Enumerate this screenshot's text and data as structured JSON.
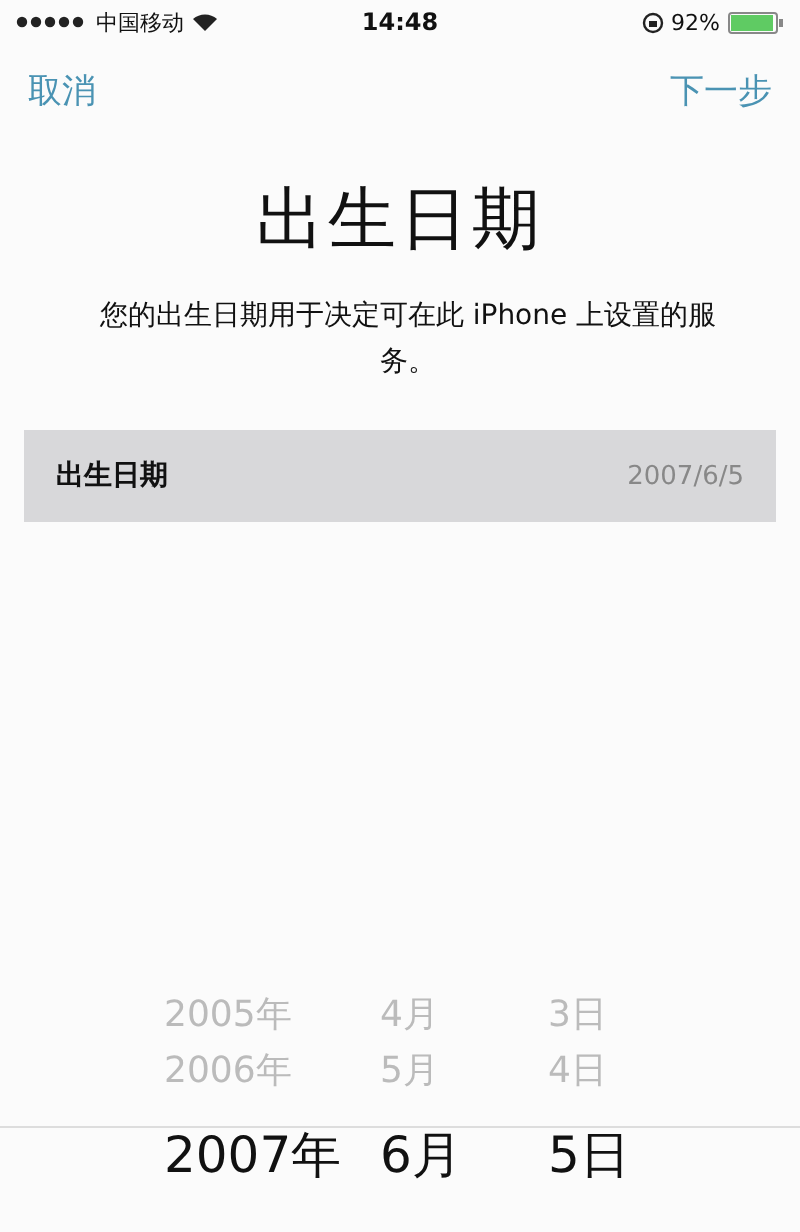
{
  "status_bar": {
    "carrier": "中国移动",
    "time": "14:48",
    "battery": "92%"
  },
  "nav": {
    "cancel": "取消",
    "next": "下一步"
  },
  "title": "出生日期",
  "description": "您的出生日期用于决定可在此 iPhone 上设置的服务。",
  "field": {
    "label": "出生日期",
    "value": "2007/6/5",
    "selected": true
  },
  "picker": {
    "columns": [
      {
        "items": [
          {
            "label": "2005年",
            "selected": false
          },
          {
            "label": "2006年",
            "selected": false
          },
          {
            "label": "2007年",
            "selected": true
          }
        ]
      },
      {
        "items": [
          {
            "label": "4月",
            "selected": false
          },
          {
            "label": "5月",
            "selected": false
          },
          {
            "label": "6月",
            "selected": true
          }
        ]
      },
      {
        "items": [
          {
            "label": "3日",
            "selected": false
          },
          {
            "label": "4日",
            "selected": false
          },
          {
            "label": "5日",
            "selected": true
          }
        ]
      }
    ]
  }
}
